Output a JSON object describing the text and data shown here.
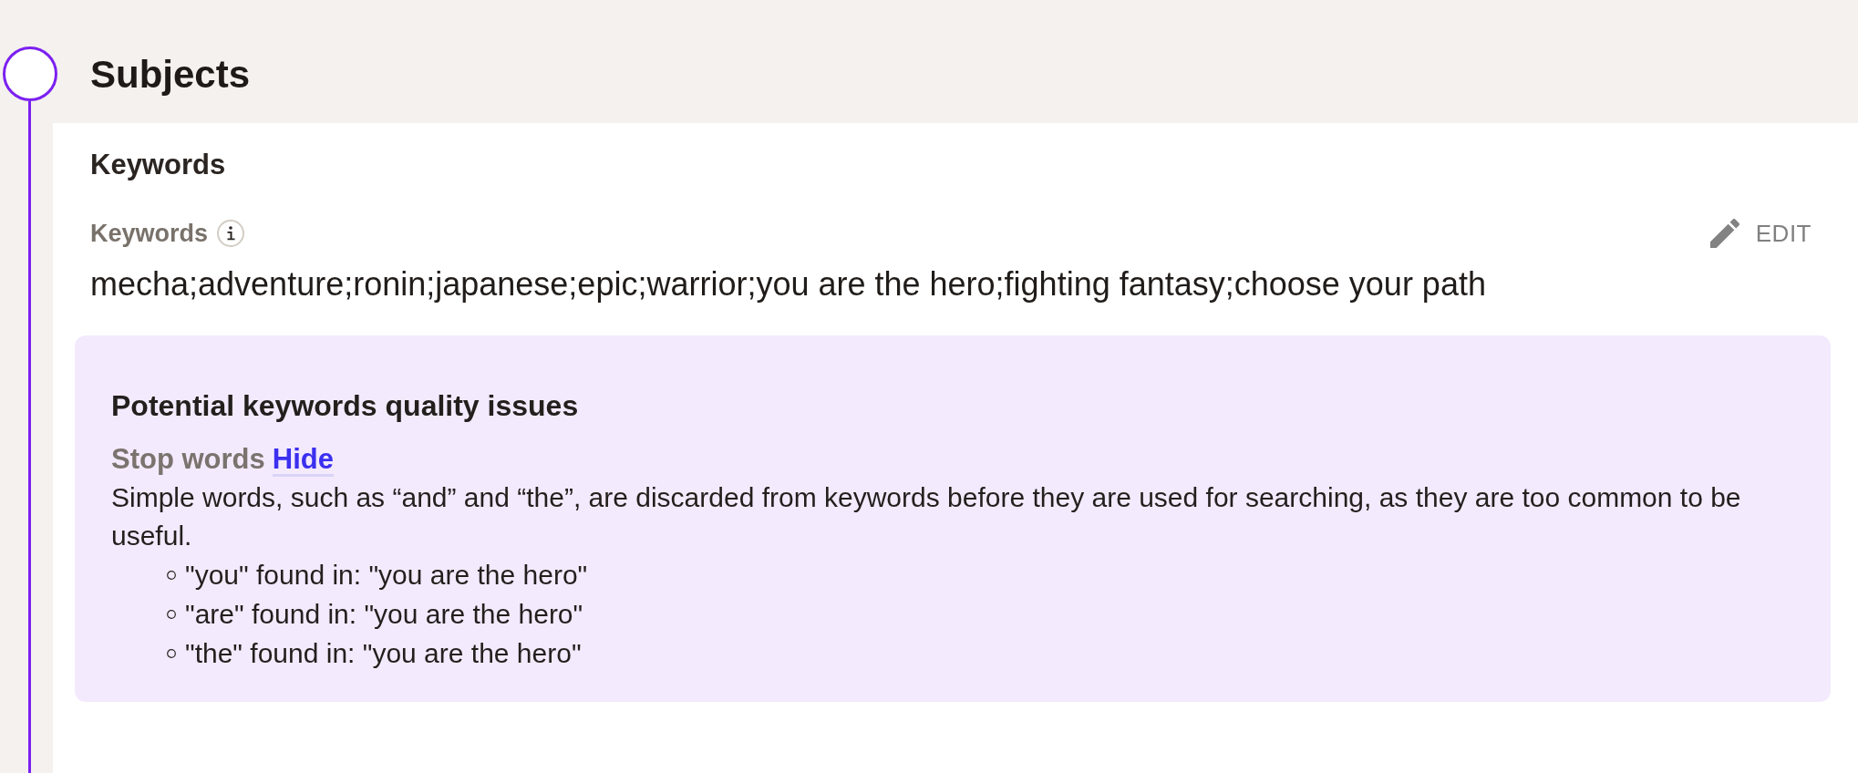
{
  "section": {
    "title": "Subjects"
  },
  "keywords_panel": {
    "heading": "Keywords",
    "field": {
      "label": "Keywords",
      "edit_button": "EDIT",
      "value": "mecha;adventure;ronin;japanese;epic;warrior;you are the hero;fighting fantasy;choose your path"
    }
  },
  "quality_issues": {
    "title": "Potential keywords quality issues",
    "category": "Stop words",
    "toggle_link": "Hide",
    "description": "Simple words, such as “and” and “the”, are discarded from keywords before they are used for searching, as they are too common to be useful.",
    "items": [
      "\"you\" found in: \"you are the hero\"",
      "\"are\" found in: \"you are the hero\"",
      "\"the\" found in: \"you are the hero\""
    ]
  }
}
